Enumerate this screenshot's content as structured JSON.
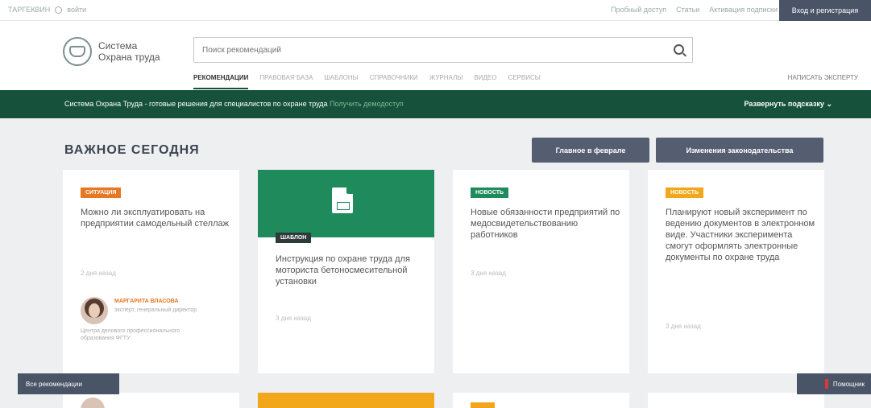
{
  "topbar": {
    "left_text": "ТАРГЕКВИН",
    "user_label": "войти",
    "links": [
      "Пробный доступ",
      "Статьи",
      "Активация подписки"
    ],
    "register_label": "Вход и регистрация"
  },
  "header": {
    "logo_line1": "Система",
    "logo_line2": "Охрана труда",
    "search_placeholder": "Поиск рекомендаций",
    "nav": [
      "Рекомендации",
      "Правовая база",
      "Шаблоны",
      "Справочники",
      "Журналы",
      "Видео",
      "Сервисы"
    ],
    "write_expert": "Написать эксперту"
  },
  "banner": {
    "text": "Система Охрана Труда - готовые решения для специалистов по охране труда",
    "link": "Получить демодоступ",
    "expand": "Развернуть подсказку"
  },
  "section": {
    "title": "ВАЖНОЕ СЕГОДНЯ",
    "btn_main": "Главное в феврале",
    "btn_law": "Изменения законодательства"
  },
  "cards": [
    {
      "badge": "Ситуация",
      "title": "Можно ли эксплуатировать на предприятии самодельный стеллаж",
      "time": "2 дня назад",
      "author_name": "Маргарита Власова",
      "author_role": "эксперт, генеральный директор",
      "author_org": "Центра делового профессионального образования ФГТУ"
    },
    {
      "badge": "Шаблон",
      "title": "Инструкция по охране труда для моториста бетоносмесительной установки",
      "time": "3 дня назад"
    },
    {
      "badge": "Новость",
      "title": "Новые обязанности предприятий по медосвидетельствованию работников",
      "time": "3 дня назад"
    },
    {
      "badge": "Новость",
      "title": "Планируют новый эксперимент по ведению документов в электронном виде. Участники эксперимента смогут оформлять электронные документы по охране труда",
      "time": "3 дня назад"
    }
  ],
  "floating": {
    "all_recs": "Все рекомендации",
    "help": "Помощник"
  }
}
